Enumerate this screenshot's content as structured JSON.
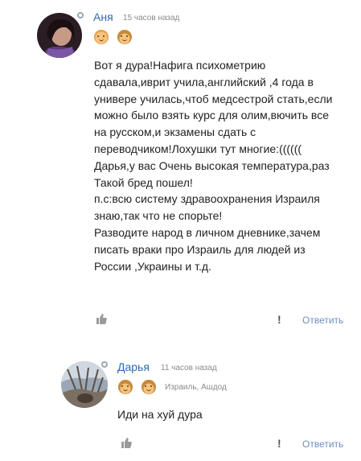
{
  "comments": [
    {
      "author": "Аня",
      "time": "15 часов назад",
      "text": "Вот я дура!Нафига психометрию\nсдавала,иврит учила,английский ,4 года в\nунивере училась,чтоб медсестрой стать,если\nможно было взять курс для олим,вючить все\nна русском,и экзамены сдать с\nпереводчиком!Лохушки тут многие:((((((\nДарья,у вас Очень высокая температура,раз\nТакой бред пошел!\nп.с:всю систему здравоохранения Израиля\nзнаю,так что не спорьте!\nРазводите народ в личном дневнике,зачем\nписать враки про Израиль для людей из\nРоссии ,Украины и т.д.",
      "flag": "!",
      "reply": "Ответить"
    },
    {
      "author": "Дарья",
      "time": "11 часов назад",
      "location": "Израиль, Ашдод",
      "text": "Иди на хуй дура",
      "flag": "!",
      "reply": "Ответить"
    }
  ],
  "icons": {
    "like": "thumbs-up-icon",
    "emoji_badge": "smiley-face-icon"
  },
  "colors": {
    "link": "#2b6bb1",
    "reply": "#6d8fbf",
    "muted": "#8a8a8a"
  }
}
